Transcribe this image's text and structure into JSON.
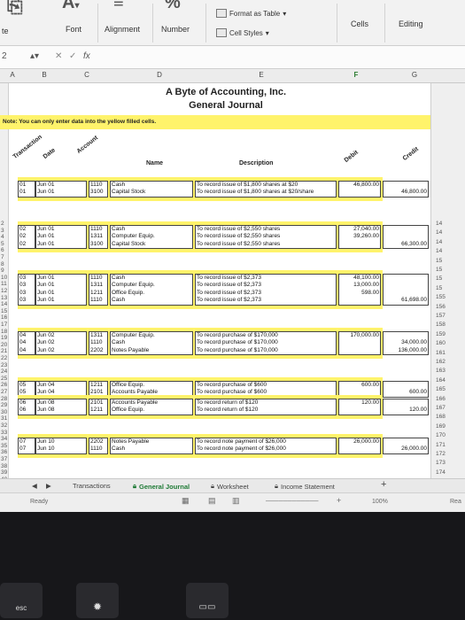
{
  "ribbon": {
    "tab_left": "te",
    "font_label": "Font",
    "alignment_label": "Alignment",
    "number_label": "Number",
    "format_as_table": "Format as Table",
    "cell_styles": "Cell Styles",
    "cells_label": "Cells",
    "editing_label": "Editing"
  },
  "formula_bar": {
    "name_box": "2",
    "fx": "fx"
  },
  "columns": [
    "A",
    "B",
    "C",
    "D",
    "E",
    "F",
    "G"
  ],
  "selected_column": "F",
  "sheet": {
    "title1": "A Byte of Accounting, Inc.",
    "title2": "General Journal",
    "note": "Note: You can only enter data into the yellow filled cells.",
    "headers": {
      "transaction": "Transaction",
      "date": "Date",
      "account": "Account",
      "name": "Name",
      "description": "Description",
      "debit": "Debit",
      "credit": "Credit"
    }
  },
  "entries": [
    {
      "rows": [
        {
          "t": "01",
          "d": "Jun 01",
          "a": "1110",
          "n": "Cash",
          "desc": "To record issue of $1,800 shares at $20",
          "dr": "46,800.00",
          "cr": ""
        },
        {
          "t": "01",
          "d": "Jun 01",
          "a": "3100",
          "n": "Capital Stock",
          "desc": "To record issue of $1,800 shares at $20/share",
          "dr": "",
          "cr": "46,800.00"
        }
      ]
    },
    {
      "rows": [
        {
          "t": "02",
          "d": "Jun 01",
          "a": "1110",
          "n": "Cash",
          "desc": "To record issue of $2,550 shares",
          "dr": "27,040.00",
          "cr": ""
        },
        {
          "t": "02",
          "d": "Jun 01",
          "a": "1311",
          "n": "Computer Equip.",
          "desc": "To record issue of $2,550 shares",
          "dr": "39,260.00",
          "cr": ""
        },
        {
          "t": "02",
          "d": "Jun 01",
          "a": "3100",
          "n": "Capital Stock",
          "desc": "To record issue of $2,550 shares",
          "dr": "",
          "cr": "66,300.00"
        }
      ]
    },
    {
      "rows": [
        {
          "t": "03",
          "d": "Jun 01",
          "a": "1110",
          "n": "Cash",
          "desc": "To record issue of $2,373",
          "dr": "48,100.00",
          "cr": ""
        },
        {
          "t": "03",
          "d": "Jun 01",
          "a": "1311",
          "n": "Computer Equip.",
          "desc": "To record issue of $2,373",
          "dr": "13,000.00",
          "cr": ""
        },
        {
          "t": "03",
          "d": "Jun 01",
          "a": "1211",
          "n": "Office Equip.",
          "desc": "To record issue of $2,373",
          "dr": "598.00",
          "cr": ""
        },
        {
          "t": "03",
          "d": "Jun 01",
          "a": "1110",
          "n": "Cash",
          "desc": "To record issue of $2,373",
          "dr": "",
          "cr": "61,698.00"
        }
      ]
    },
    {
      "rows": [
        {
          "t": "04",
          "d": "Jun 02",
          "a": "1311",
          "n": "Computer Equip.",
          "desc": "To record purchase of $170,000",
          "dr": "170,000.00",
          "cr": ""
        },
        {
          "t": "04",
          "d": "Jun 02",
          "a": "1110",
          "n": "Cash",
          "desc": "To record purchase of $170,000",
          "dr": "",
          "cr": "34,000.00"
        },
        {
          "t": "04",
          "d": "Jun 02",
          "a": "2202",
          "n": "Notes Payable",
          "desc": "To record purchase of $170,000",
          "dr": "",
          "cr": "136,000.00"
        }
      ]
    },
    {
      "rows": [
        {
          "t": "05",
          "d": "Jun 04",
          "a": "1211",
          "n": "Office Equip.",
          "desc": "To record purchase of $600",
          "dr": "600.00",
          "cr": ""
        },
        {
          "t": "05",
          "d": "Jun 04",
          "a": "2101",
          "n": "Accounts Payable",
          "desc": "To record purchase of $600",
          "dr": "",
          "cr": "600.00"
        }
      ]
    },
    {
      "rows": [
        {
          "t": "06",
          "d": "Jun 08",
          "a": "2101",
          "n": "Accounts Payable",
          "desc": "To record return of $120",
          "dr": "120.00",
          "cr": ""
        },
        {
          "t": "06",
          "d": "Jun 08",
          "a": "1211",
          "n": "Office Equip.",
          "desc": "To record return of $120",
          "dr": "",
          "cr": "120.00"
        }
      ]
    },
    {
      "rows": [
        {
          "t": "07",
          "d": "Jun 10",
          "a": "2202",
          "n": "Notes Payable",
          "desc": "To record note payment of $26,000",
          "dr": "26,000.00",
          "cr": ""
        },
        {
          "t": "07",
          "d": "Jun 10",
          "a": "1110",
          "n": "Cash",
          "desc": "To record note payment of $26,000",
          "dr": "",
          "cr": "26,000.00"
        }
      ]
    }
  ],
  "left_row_numbers": [
    "2",
    "3",
    "4",
    "5",
    "6",
    "7",
    "8",
    "9",
    "10",
    "11",
    "12",
    "13",
    "14",
    "15",
    "16",
    "17",
    "18",
    "19",
    "20",
    "21",
    "22",
    "23",
    "24",
    "25",
    "26",
    "27",
    "28",
    "29",
    "30",
    "31",
    "32",
    "33",
    "34",
    "35",
    "36",
    "37",
    "38",
    "39",
    "40"
  ],
  "right_row_numbers": [
    "14",
    "14",
    "14",
    "14",
    "15",
    "15",
    "15",
    "15",
    "155",
    "156",
    "157",
    "158",
    "159",
    "160",
    "161",
    "162",
    "163",
    "164",
    "165",
    "166",
    "167",
    "168",
    "169",
    "170",
    "171",
    "172",
    "173",
    "174",
    "175",
    "176"
  ],
  "sheet_tabs": [
    "Transactions",
    "General Journal",
    "Worksheet",
    "Income Statement"
  ],
  "active_tab": "General Journal",
  "status": {
    "ready": "Ready",
    "zoom": "100%",
    "right": "Rea"
  },
  "keyboard": {
    "esc": "esc"
  }
}
